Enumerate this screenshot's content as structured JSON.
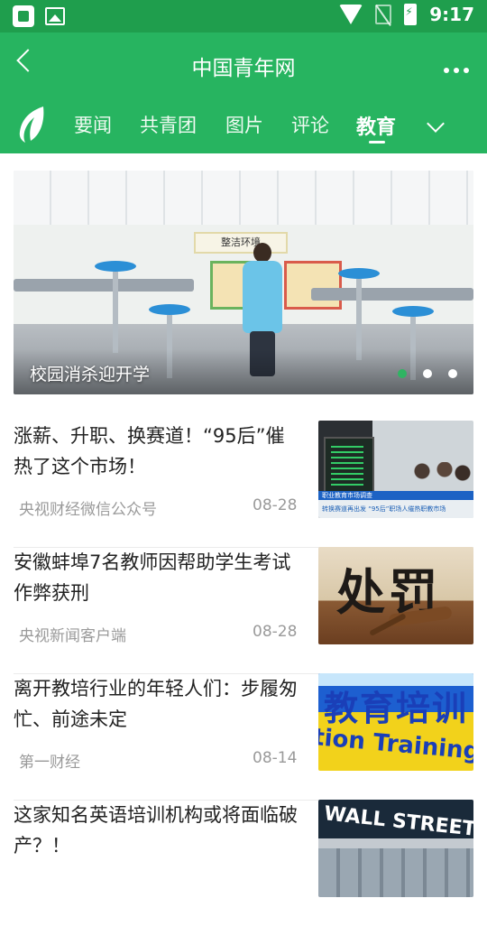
{
  "status_bar": {
    "time": "9:17"
  },
  "app_bar": {
    "title": "中国青年网"
  },
  "tabs": [
    {
      "label": "要闻",
      "active": false
    },
    {
      "label": "共青团",
      "active": false
    },
    {
      "label": "图片",
      "active": false
    },
    {
      "label": "评论",
      "active": false
    },
    {
      "label": "教育",
      "active": true
    }
  ],
  "banner": {
    "caption": "校园消杀迎开学",
    "sign_text": "整洁环境",
    "page_count": 3,
    "active_page": 1
  },
  "news": [
    {
      "title": "涨薪、升职、换赛道！“95后”催热了这个市场！",
      "source": "央视财经微信公众号",
      "date": "08-28",
      "thumb_text": "转换赛道再出发 “95后”职场人催热职教市场",
      "thumb_subtext": "职业教育市场调查"
    },
    {
      "title": "安徽蚌埠7名教师因帮助学生考试作弊获刑",
      "source": "央视新闻客户端",
      "date": "08-28",
      "thumb_text": "处罚"
    },
    {
      "title": "离开教培行业的年轻人们：步履匆忙、前途未定",
      "source": "第一财经",
      "date": "08-14",
      "thumb_text": "教育培训",
      "thumb_subtext": "tion Training"
    },
    {
      "title": "这家知名英语培训机构或将面临破产？！",
      "source": "",
      "date": "",
      "thumb_text": "WALL STREET"
    }
  ],
  "colors": {
    "status_bar": "#1f9e4d",
    "primary": "#27b460",
    "active_dot": "#2fb462"
  }
}
